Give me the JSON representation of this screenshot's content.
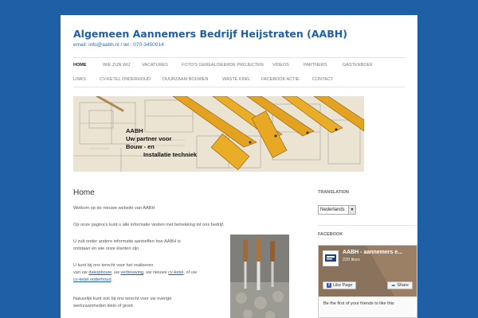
{
  "header": {
    "site_title": "Algemeen Aannemers Bedrijf Heijstraten (AABH)",
    "tagline": "email: info@aabh.nl / tel : 070-3450014"
  },
  "nav": {
    "row1": [
      "HOME",
      "WIE ZIJN WIJ",
      "VACATURES",
      "FOTO'S GEREALISEERDE PROJECTEN",
      "VIDEOS",
      "PARTNERS",
      "GASTENBOEK"
    ],
    "row2": [
      "LINKS",
      "CV-KETEL ONDERHOUD",
      "DUURZAAM BOUWEN",
      "WASTE KING",
      "FACEBOOK ACTIE",
      "CONTACT"
    ],
    "active": "HOME"
  },
  "hero": {
    "line1": "AABH",
    "line2": "Uw partner voor",
    "line3": "Bouw - en",
    "line4": "Installatie techniek"
  },
  "content": {
    "title": "Home",
    "p1": "Welkom op de nieuwe website van AABH",
    "p2": "Op onze pagina's kunt u alle informatie vinden met betrekking tot ons bedrijf.",
    "p3a": "U zult onder andere informatie aantreffen hoe AABH is",
    "p3b": "ontstaan en wie onze klanten zijn.",
    "p4a": "U kunt bij ons terecht voor het realiseren",
    "p4b_pre": "van uw ",
    "p4b_link1": "dakopbouw",
    "p4b_sep1": ", uw ",
    "p4b_link2": "verbouwing",
    "p4b_sep2": ", uw nieuwe ",
    "p4b_link3": "cv-ketel",
    "p4b_sep3": ", of uw",
    "p4c_link": "cv-ketel onderhoud",
    "p4c_post": ".",
    "p5a": "Natuurlijk kunt ook bij ons terecht voor uw overige",
    "p5b": "werkzaamheden klein of groot."
  },
  "sidebar": {
    "translation_title": "TRANSLATION",
    "language_selected": "Nederlands",
    "facebook_title": "FACEBOOK",
    "fb_page_name": "AABH - aannemers  e...",
    "fb_likes": "220 likes",
    "fb_like_label": "Like Page",
    "fb_share_label": "Share",
    "fb_friends_text": "Be the first of your friends to like this"
  },
  "colors": {
    "background": "#1f5fa6",
    "title": "#1f5fa6",
    "link": "#1f5fa6",
    "facebook": "#3b5998"
  }
}
